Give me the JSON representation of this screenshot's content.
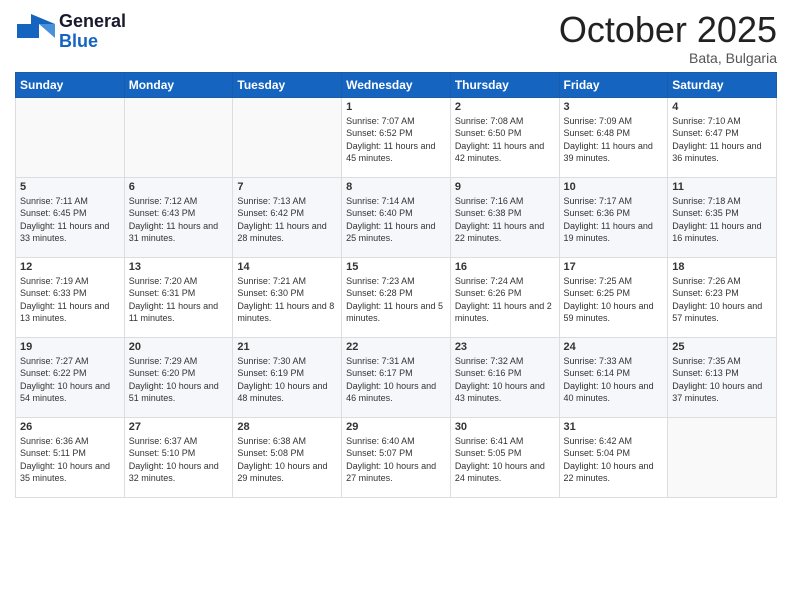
{
  "header": {
    "logo_general": "General",
    "logo_blue": "Blue",
    "month_title": "October 2025",
    "location": "Bata, Bulgaria"
  },
  "weekdays": [
    "Sunday",
    "Monday",
    "Tuesday",
    "Wednesday",
    "Thursday",
    "Friday",
    "Saturday"
  ],
  "rows": [
    [
      {
        "num": "",
        "sunrise": "",
        "sunset": "",
        "daylight": ""
      },
      {
        "num": "",
        "sunrise": "",
        "sunset": "",
        "daylight": ""
      },
      {
        "num": "",
        "sunrise": "",
        "sunset": "",
        "daylight": ""
      },
      {
        "num": "1",
        "sunrise": "Sunrise: 7:07 AM",
        "sunset": "Sunset: 6:52 PM",
        "daylight": "Daylight: 11 hours and 45 minutes."
      },
      {
        "num": "2",
        "sunrise": "Sunrise: 7:08 AM",
        "sunset": "Sunset: 6:50 PM",
        "daylight": "Daylight: 11 hours and 42 minutes."
      },
      {
        "num": "3",
        "sunrise": "Sunrise: 7:09 AM",
        "sunset": "Sunset: 6:48 PM",
        "daylight": "Daylight: 11 hours and 39 minutes."
      },
      {
        "num": "4",
        "sunrise": "Sunrise: 7:10 AM",
        "sunset": "Sunset: 6:47 PM",
        "daylight": "Daylight: 11 hours and 36 minutes."
      }
    ],
    [
      {
        "num": "5",
        "sunrise": "Sunrise: 7:11 AM",
        "sunset": "Sunset: 6:45 PM",
        "daylight": "Daylight: 11 hours and 33 minutes."
      },
      {
        "num": "6",
        "sunrise": "Sunrise: 7:12 AM",
        "sunset": "Sunset: 6:43 PM",
        "daylight": "Daylight: 11 hours and 31 minutes."
      },
      {
        "num": "7",
        "sunrise": "Sunrise: 7:13 AM",
        "sunset": "Sunset: 6:42 PM",
        "daylight": "Daylight: 11 hours and 28 minutes."
      },
      {
        "num": "8",
        "sunrise": "Sunrise: 7:14 AM",
        "sunset": "Sunset: 6:40 PM",
        "daylight": "Daylight: 11 hours and 25 minutes."
      },
      {
        "num": "9",
        "sunrise": "Sunrise: 7:16 AM",
        "sunset": "Sunset: 6:38 PM",
        "daylight": "Daylight: 11 hours and 22 minutes."
      },
      {
        "num": "10",
        "sunrise": "Sunrise: 7:17 AM",
        "sunset": "Sunset: 6:36 PM",
        "daylight": "Daylight: 11 hours and 19 minutes."
      },
      {
        "num": "11",
        "sunrise": "Sunrise: 7:18 AM",
        "sunset": "Sunset: 6:35 PM",
        "daylight": "Daylight: 11 hours and 16 minutes."
      }
    ],
    [
      {
        "num": "12",
        "sunrise": "Sunrise: 7:19 AM",
        "sunset": "Sunset: 6:33 PM",
        "daylight": "Daylight: 11 hours and 13 minutes."
      },
      {
        "num": "13",
        "sunrise": "Sunrise: 7:20 AM",
        "sunset": "Sunset: 6:31 PM",
        "daylight": "Daylight: 11 hours and 11 minutes."
      },
      {
        "num": "14",
        "sunrise": "Sunrise: 7:21 AM",
        "sunset": "Sunset: 6:30 PM",
        "daylight": "Daylight: 11 hours and 8 minutes."
      },
      {
        "num": "15",
        "sunrise": "Sunrise: 7:23 AM",
        "sunset": "Sunset: 6:28 PM",
        "daylight": "Daylight: 11 hours and 5 minutes."
      },
      {
        "num": "16",
        "sunrise": "Sunrise: 7:24 AM",
        "sunset": "Sunset: 6:26 PM",
        "daylight": "Daylight: 11 hours and 2 minutes."
      },
      {
        "num": "17",
        "sunrise": "Sunrise: 7:25 AM",
        "sunset": "Sunset: 6:25 PM",
        "daylight": "Daylight: 10 hours and 59 minutes."
      },
      {
        "num": "18",
        "sunrise": "Sunrise: 7:26 AM",
        "sunset": "Sunset: 6:23 PM",
        "daylight": "Daylight: 10 hours and 57 minutes."
      }
    ],
    [
      {
        "num": "19",
        "sunrise": "Sunrise: 7:27 AM",
        "sunset": "Sunset: 6:22 PM",
        "daylight": "Daylight: 10 hours and 54 minutes."
      },
      {
        "num": "20",
        "sunrise": "Sunrise: 7:29 AM",
        "sunset": "Sunset: 6:20 PM",
        "daylight": "Daylight: 10 hours and 51 minutes."
      },
      {
        "num": "21",
        "sunrise": "Sunrise: 7:30 AM",
        "sunset": "Sunset: 6:19 PM",
        "daylight": "Daylight: 10 hours and 48 minutes."
      },
      {
        "num": "22",
        "sunrise": "Sunrise: 7:31 AM",
        "sunset": "Sunset: 6:17 PM",
        "daylight": "Daylight: 10 hours and 46 minutes."
      },
      {
        "num": "23",
        "sunrise": "Sunrise: 7:32 AM",
        "sunset": "Sunset: 6:16 PM",
        "daylight": "Daylight: 10 hours and 43 minutes."
      },
      {
        "num": "24",
        "sunrise": "Sunrise: 7:33 AM",
        "sunset": "Sunset: 6:14 PM",
        "daylight": "Daylight: 10 hours and 40 minutes."
      },
      {
        "num": "25",
        "sunrise": "Sunrise: 7:35 AM",
        "sunset": "Sunset: 6:13 PM",
        "daylight": "Daylight: 10 hours and 37 minutes."
      }
    ],
    [
      {
        "num": "26",
        "sunrise": "Sunrise: 6:36 AM",
        "sunset": "Sunset: 5:11 PM",
        "daylight": "Daylight: 10 hours and 35 minutes."
      },
      {
        "num": "27",
        "sunrise": "Sunrise: 6:37 AM",
        "sunset": "Sunset: 5:10 PM",
        "daylight": "Daylight: 10 hours and 32 minutes."
      },
      {
        "num": "28",
        "sunrise": "Sunrise: 6:38 AM",
        "sunset": "Sunset: 5:08 PM",
        "daylight": "Daylight: 10 hours and 29 minutes."
      },
      {
        "num": "29",
        "sunrise": "Sunrise: 6:40 AM",
        "sunset": "Sunset: 5:07 PM",
        "daylight": "Daylight: 10 hours and 27 minutes."
      },
      {
        "num": "30",
        "sunrise": "Sunrise: 6:41 AM",
        "sunset": "Sunset: 5:05 PM",
        "daylight": "Daylight: 10 hours and 24 minutes."
      },
      {
        "num": "31",
        "sunrise": "Sunrise: 6:42 AM",
        "sunset": "Sunset: 5:04 PM",
        "daylight": "Daylight: 10 hours and 22 minutes."
      },
      {
        "num": "",
        "sunrise": "",
        "sunset": "",
        "daylight": ""
      }
    ]
  ]
}
